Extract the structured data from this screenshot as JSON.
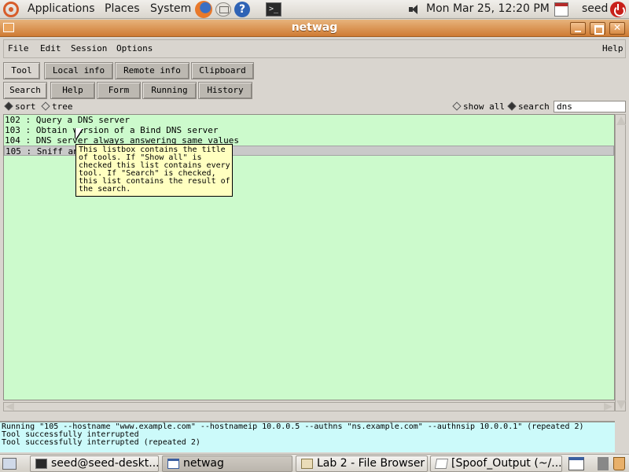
{
  "top_panel": {
    "applications": "Applications",
    "places": "Places",
    "system": "System",
    "clock": "Mon Mar 25, 12:20 PM",
    "user": "seed"
  },
  "window": {
    "title": "netwag",
    "menu": {
      "file": "File",
      "edit": "Edit",
      "session": "Session",
      "options": "Options",
      "help": "Help"
    },
    "tabs_top": [
      "Tool",
      "Local info",
      "Remote info",
      "Clipboard"
    ],
    "tabs_sub": [
      "Search",
      "Help",
      "Form",
      "Running",
      "History"
    ],
    "options": {
      "sort": "sort",
      "tree": "tree",
      "show_all": "show all",
      "search": "search",
      "search_value": "dns"
    },
    "list": [
      "102 : Query a DNS server",
      "103 : Obtain version of a Bind DNS server",
      "104 : DNS server always answering same values",
      "105 : Sniff and send DNS answers"
    ],
    "tooltip": [
      "This listbox contains the title",
      "of tools. If \"Show all\" is",
      "checked this list contains every",
      "tool. If \"Search\" is checked,",
      "this list contains the result of",
      "the search."
    ],
    "output": [
      "Running \"105 --hostname \"www.example.com\" --hostnameip 10.0.0.5 --authns \"ns.example.com\" --authnsip 10.0.0.1\" (repeated 2)",
      "Tool successfully interrupted",
      "Tool successfully interrupted (repeated 2)"
    ]
  },
  "taskbar": {
    "items": [
      "seed@seed-deskt...",
      "netwag",
      "Lab 2 - File Browser",
      "[Spoof_Output (~/..."
    ]
  },
  "colors": {
    "list_bg": "#ccfacc",
    "output_bg": "#ccfafa",
    "tooltip_bg": "#ffffc0",
    "titlebar": "#d98a45"
  }
}
